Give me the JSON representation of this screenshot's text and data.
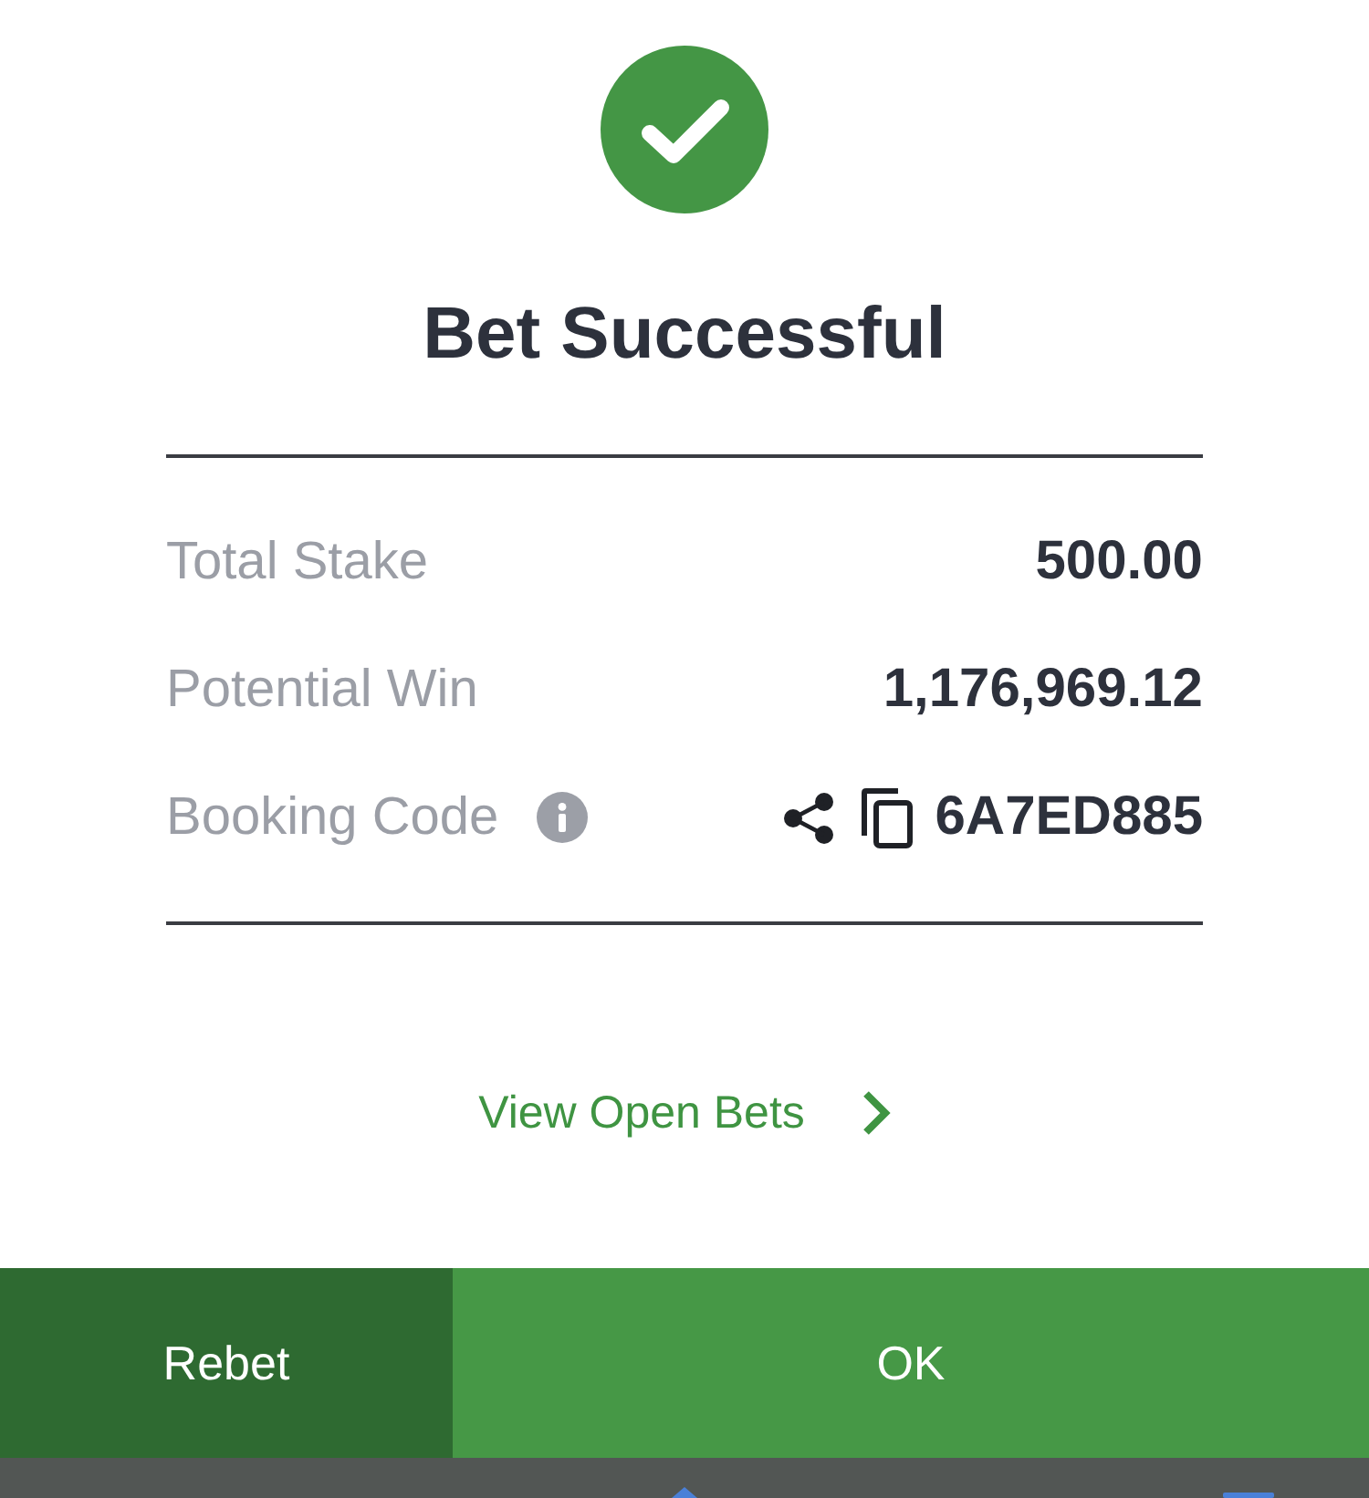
{
  "status": {
    "title": "Bet Successful"
  },
  "summary": [
    {
      "kind": "amount",
      "label": "Total Stake",
      "value": "500.00"
    },
    {
      "kind": "amount",
      "label": "Potential Win",
      "value": "1,176,969.12"
    },
    {
      "kind": "code",
      "label": "Booking Code",
      "value": "6A7ED885"
    }
  ],
  "link": {
    "label": "View Open Bets"
  },
  "buttons": [
    {
      "kind": "secondary",
      "label": "Rebet"
    },
    {
      "kind": "primary",
      "label": "OK"
    }
  ]
}
